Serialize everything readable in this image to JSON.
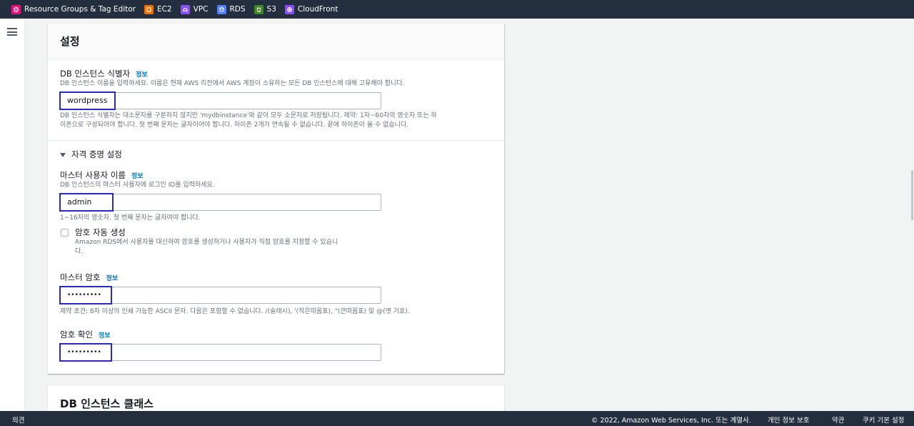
{
  "topnav": {
    "services": [
      {
        "label": "Resource Groups & Tag Editor",
        "icon": "resource-groups-icon",
        "color": "#e7157b"
      },
      {
        "label": "EC2",
        "icon": "ec2-icon",
        "color": "#ed7100"
      },
      {
        "label": "VPC",
        "icon": "vpc-icon",
        "color": "#8c4fff"
      },
      {
        "label": "RDS",
        "icon": "rds-icon",
        "color": "#527fff"
      },
      {
        "label": "S3",
        "icon": "s3-icon",
        "color": "#3f8624"
      },
      {
        "label": "CloudFront",
        "icon": "cloudfront-icon",
        "color": "#8c4fff"
      }
    ]
  },
  "settings": {
    "title": "설정",
    "instance_id": {
      "label": "DB 인스턴스 식별자",
      "info": "정보",
      "description": "DB 인스턴스 이름을 입력하세요. 이름은 현재 AWS 리전에서 AWS 계정이 소유하는 모든 DB 인스턴스에 대해 고유해야 합니다.",
      "value": "wordpress",
      "constraint_line1": "DB 인스턴스 식별자는 대소문자를 구분하지 않지만 'mydbinstance'와 같이 모두 소문자로 저장됩니다. 제약: 1자~60자의 영숫자 또는 하",
      "constraint_line2": "이픈으로 구성되어야 합니다. 첫 번째 문자는 글자이어야 합니다. 하이픈 2개가 연속될 수 없습니다. 끝에 하이픈이 올 수 없습니다."
    },
    "credentials": {
      "title": "자격 증명 설정",
      "master_username": {
        "label": "마스터 사용자 이름",
        "info": "정보",
        "description": "DB 인스턴스의 마스터 사용자에 로그인 ID를 입력하세요.",
        "value": "admin",
        "constraint": "1~16자의 영숫자. 첫 번째 문자는 글자여야 합니다."
      },
      "auto_password": {
        "label": "암호 자동 생성",
        "description_line1": "Amazon RDS에서 사용자를 대신하여 암호를 생성하거나 사용자가 직접 암호를 지정할 수 있습니",
        "description_line2": "다."
      },
      "master_password": {
        "label": "마스터 암호",
        "info": "정보",
        "value": "•••••••••",
        "constraint": "제약 조건: 8자 이상의 인쇄 가능한 ASCII 문자. 다음은 포함할 수 없습니다. /(슬래시), '(작은따옴표), \"(큰따옴표) 및 @(앳 기호)."
      },
      "confirm_password": {
        "label": "암호 확인",
        "info": "정보",
        "value": "•••••••••"
      }
    }
  },
  "instance_class": {
    "title": "DB 인스턴스 클래스"
  },
  "footer": {
    "feedback": "의견",
    "copyright": "© 2022, Amazon Web Services, Inc. 또는 계열사.",
    "privacy": "개인 정보 보호",
    "terms": "약관",
    "cookies": "쿠키 기본 설정"
  }
}
